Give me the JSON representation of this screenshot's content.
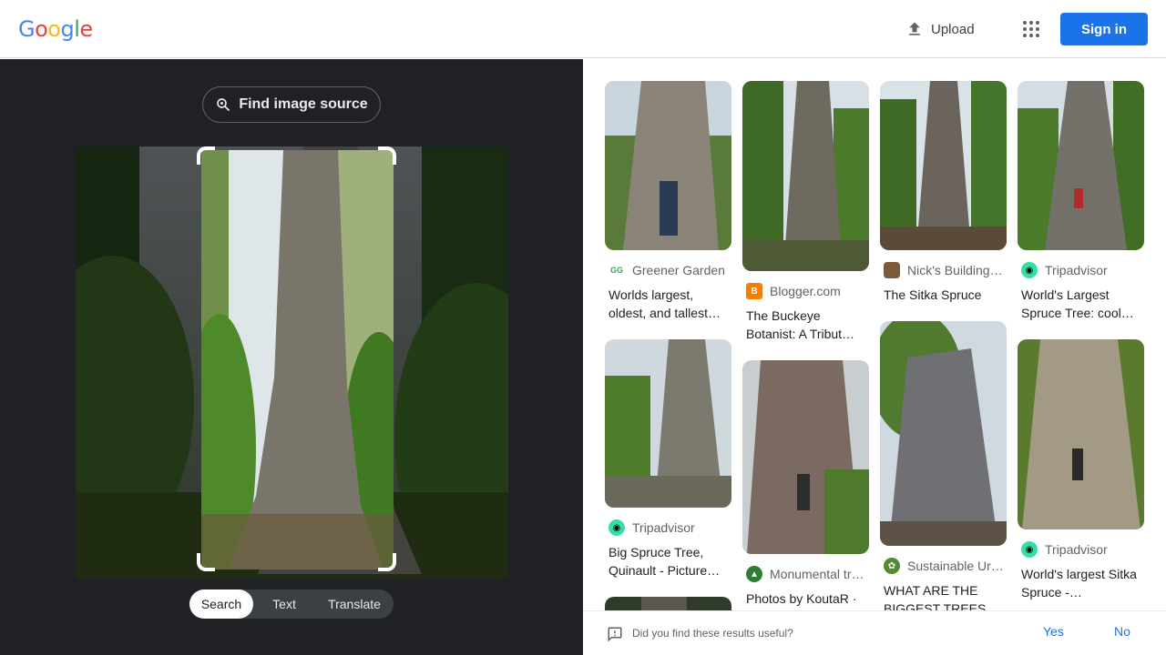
{
  "header": {
    "logo_letters": [
      {
        "ch": "G",
        "color": "#4285F4"
      },
      {
        "ch": "o",
        "color": "#EA4335"
      },
      {
        "ch": "o",
        "color": "#FBBC05"
      },
      {
        "ch": "g",
        "color": "#4285F4"
      },
      {
        "ch": "l",
        "color": "#34A853"
      },
      {
        "ch": "e",
        "color": "#EA4335"
      }
    ],
    "upload_label": "Upload",
    "signin_label": "Sign in"
  },
  "lens": {
    "find_source_label": "Find image source",
    "tabs": [
      {
        "label": "Search",
        "active": true
      },
      {
        "label": "Text",
        "active": false
      },
      {
        "label": "Translate",
        "active": false
      }
    ]
  },
  "results": [
    {
      "source": "Greener Garden",
      "title": "Worlds largest, oldest, and tallest…",
      "icon": "greener-garden-icon",
      "icon_color": "#34A853"
    },
    {
      "source": "Blogger.com",
      "title": "The Buckeye Botanist: A Tribut…",
      "icon": "blogger-icon",
      "icon_color": "#F57D00"
    },
    {
      "source": "Nick's Building…",
      "title": "The Sitka Spruce",
      "icon": "nicks-building-icon",
      "icon_color": "#7b5a3c"
    },
    {
      "source": "Tripadvisor",
      "title": "World's Largest Spruce Tree: cool…",
      "icon": "tripadvisor-icon",
      "icon_color": "#34E0A1"
    },
    {
      "source": "Tripadvisor",
      "title": "Big Spruce Tree, Quinault - Picture…",
      "icon": "tripadvisor-icon",
      "icon_color": "#34E0A1"
    },
    {
      "source": "Monumental tr…",
      "title": "Photos by KoutaR ·",
      "icon": "monumental-trees-icon",
      "icon_color": "#2e7d32"
    },
    {
      "source": "Sustainable Ur…",
      "title": "WHAT ARE THE BIGGEST TREES I…",
      "icon": "sustainable-urban-icon",
      "icon_color": "#558b2f"
    },
    {
      "source": "Tripadvisor",
      "title": "World's largest Sitka Spruce -…",
      "icon": "tripadvisor-icon",
      "icon_color": "#34E0A1"
    }
  ],
  "feedback": {
    "question": "Did you find these results useful?",
    "yes": "Yes",
    "no": "No"
  },
  "colors": {
    "accent": "#1a73e8",
    "dark_bg": "#202124"
  }
}
